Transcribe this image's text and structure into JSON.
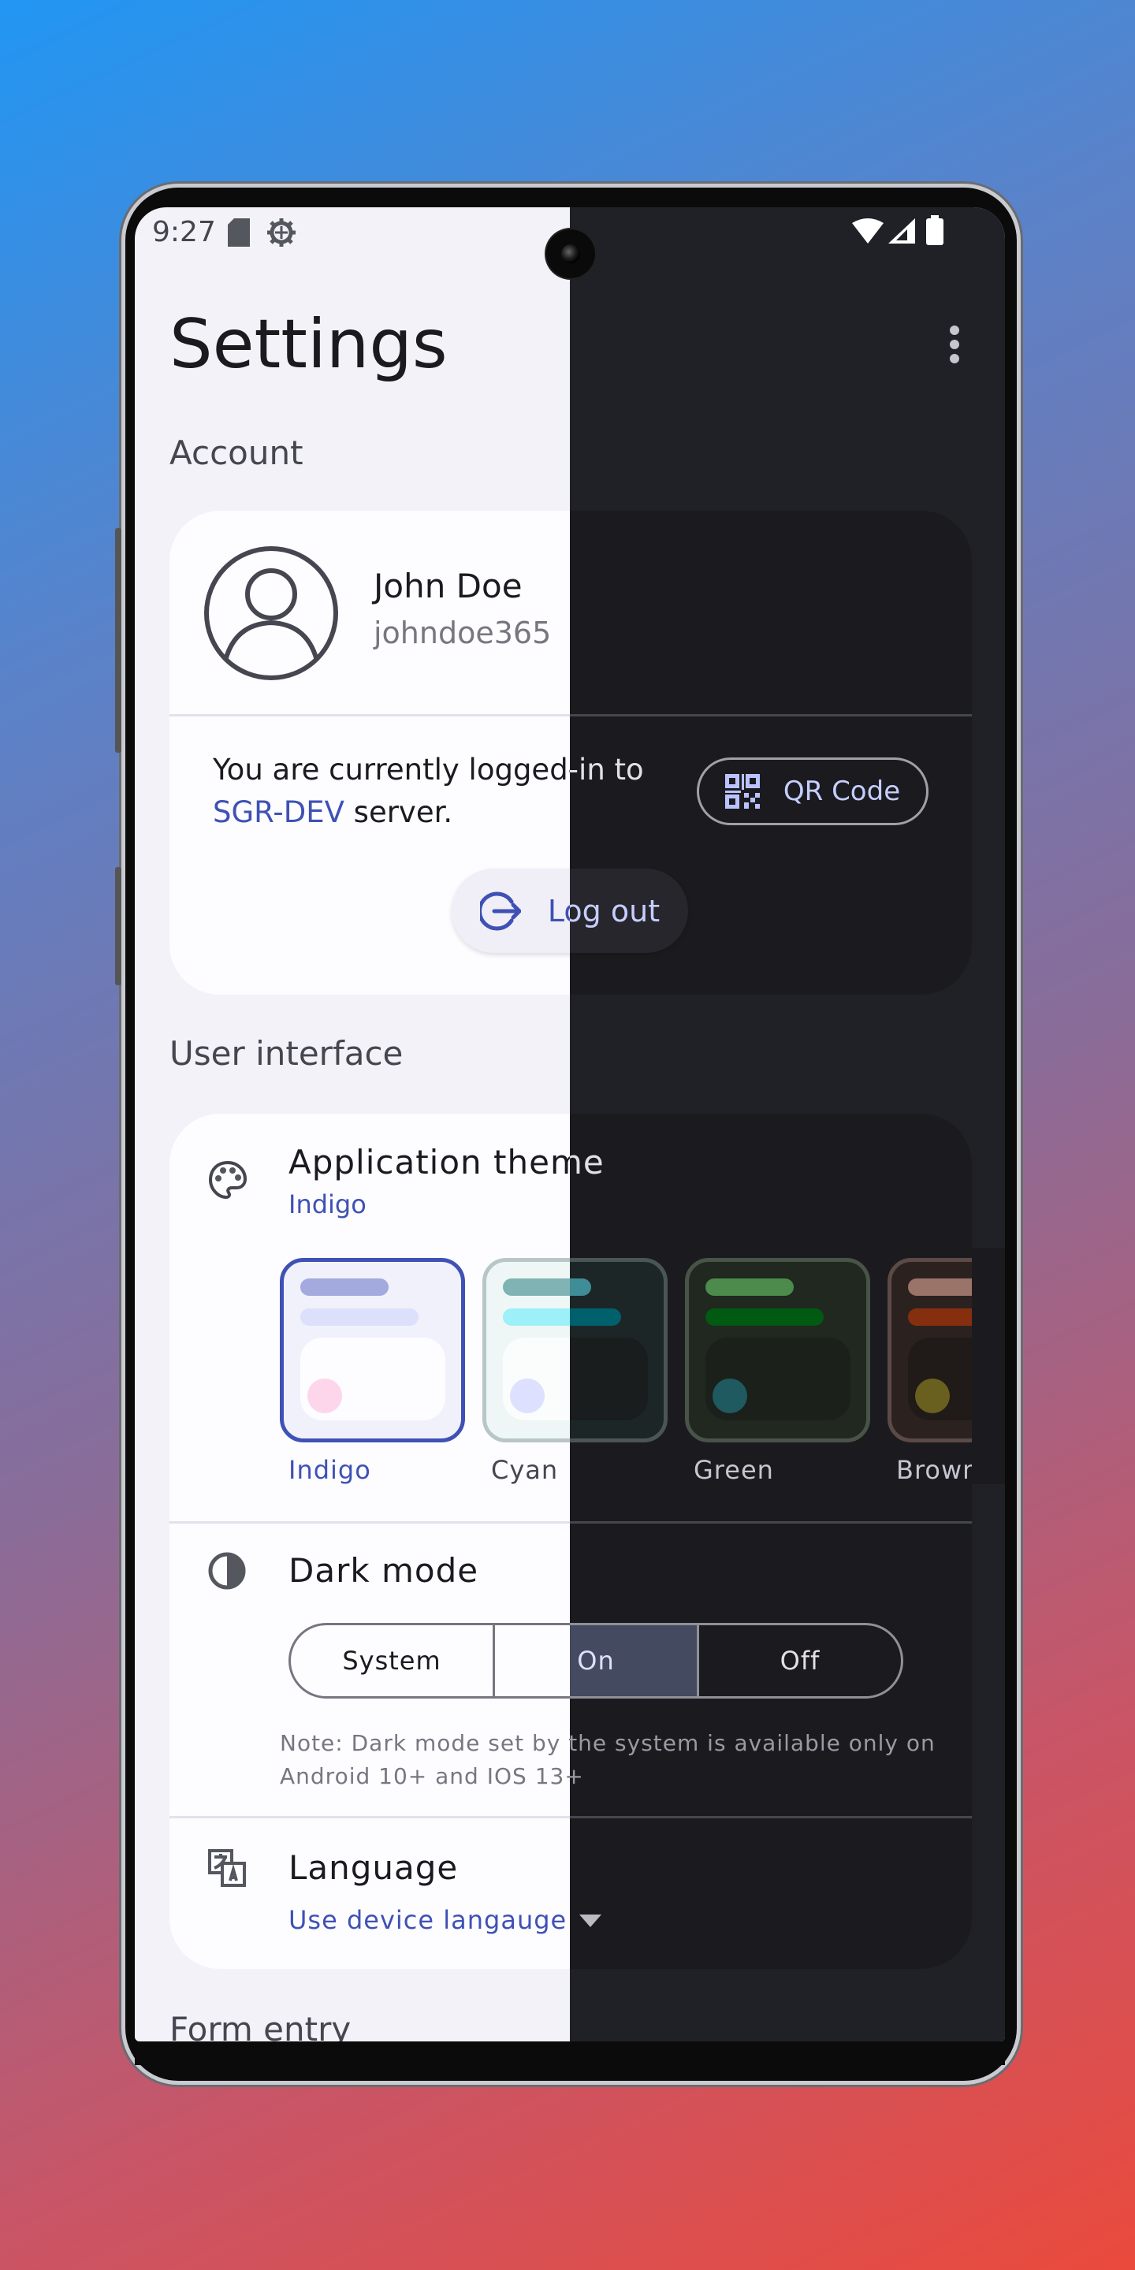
{
  "status_bar": {
    "time": "9:27",
    "icons": [
      "sd-card-icon",
      "settings-gear-icon",
      "wifi-icon",
      "signal-icon",
      "battery-icon"
    ]
  },
  "header": {
    "title": "Settings",
    "menu_icon": "more-vert-icon"
  },
  "account": {
    "section_label": "Account",
    "name": "John Doe",
    "username": "johndoe365",
    "login_text_before": "You are currently logged-in to",
    "server": "SGR-DEV",
    "login_text_after": "server.",
    "qr_button": "QR Code",
    "logout_button": "Log out"
  },
  "user_interface": {
    "section_label": "User interface",
    "theme": {
      "title": "Application theme",
      "value": "Indigo",
      "options": [
        {
          "label": "Indigo",
          "selected": true
        },
        {
          "label": "Cyan",
          "selected": false
        },
        {
          "label": "Green",
          "selected": false
        },
        {
          "label": "Brown",
          "selected": false
        }
      ]
    },
    "dark_mode": {
      "title": "Dark mode",
      "options": [
        "System",
        "On",
        "Off"
      ],
      "selected": "On",
      "note_line1": "Note: Dark mode set by the system is available only on",
      "note_line2": "Android 10+ and IOS 13+"
    },
    "language": {
      "title": "Language",
      "value": "Use device langauge"
    }
  },
  "form_entry": {
    "section_label": "Form entry"
  },
  "colors": {
    "accent_light": "#3f51b5",
    "accent_dark": "#bac3ff",
    "bg_light": "#f3f2f8",
    "bg_dark": "#202127"
  }
}
